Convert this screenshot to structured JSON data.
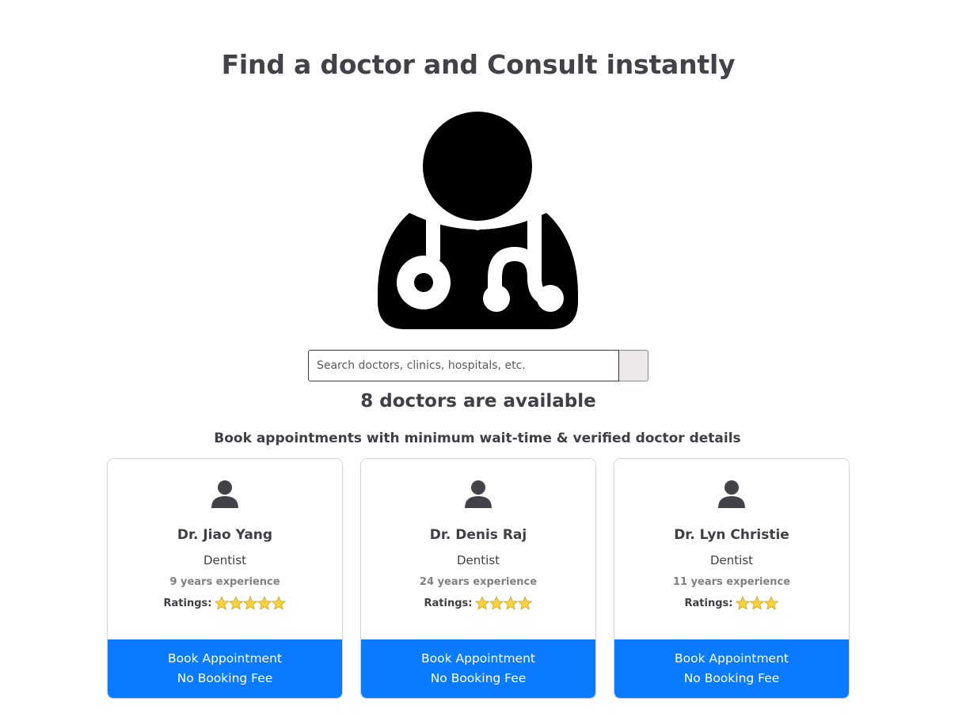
{
  "page": {
    "title": "Find a doctor and Consult instantly",
    "hero_icon": "doctor-with-stethoscope-icon"
  },
  "search": {
    "placeholder": "Search doctors, clinics, hospitals, etc.",
    "value": "",
    "button_icon": "search-icon"
  },
  "results": {
    "count_text": "8 doctors are available",
    "subtitle": "Book appointments with minimum wait-time & verified doctor details"
  },
  "doctors": [
    {
      "name": "Dr. Jiao Yang",
      "specialty": "Dentist",
      "experience": "9 years experience",
      "ratings_label": "Ratings:",
      "stars": 5,
      "button_line1": "Book Appointment",
      "button_line2": "No Booking Fee"
    },
    {
      "name": "Dr. Denis Raj",
      "specialty": "Dentist",
      "experience": "24 years experience",
      "ratings_label": "Ratings:",
      "stars": 4,
      "button_line1": "Book Appointment",
      "button_line2": "No Booking Fee"
    },
    {
      "name": "Dr. Lyn Christie",
      "specialty": "Dentist",
      "experience": "11 years experience",
      "ratings_label": "Ratings:",
      "stars": 3,
      "button_line1": "Book Appointment",
      "button_line2": "No Booking Fee"
    }
  ],
  "colors": {
    "accent": "#0a7aff",
    "text": "#3f3f46",
    "muted": "#808080",
    "star": "#f7d23a"
  }
}
